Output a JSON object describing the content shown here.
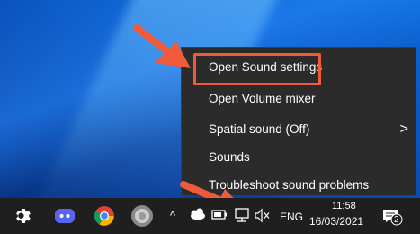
{
  "context_menu": {
    "items": [
      {
        "label": "Open Sound settings"
      },
      {
        "label": "Open Volume mixer"
      },
      {
        "label": "Spatial sound (Off)"
      },
      {
        "label": "Sounds"
      },
      {
        "label": "Troubleshoot sound problems"
      }
    ],
    "submenu_arrow": ">"
  },
  "taskbar": {
    "apps": [
      "gear-icon",
      "discord-icon",
      "chrome-icon",
      "speaker-app-icon"
    ],
    "tray": {
      "show_hidden": "^",
      "language": "ENG",
      "time": "11:58",
      "date": "16/03/2021",
      "notification_count": "2"
    }
  },
  "colors": {
    "highlight": "#f05a3a",
    "menu_bg": "#2b2b2b",
    "taskbar_bg": "#1f1f1f"
  }
}
